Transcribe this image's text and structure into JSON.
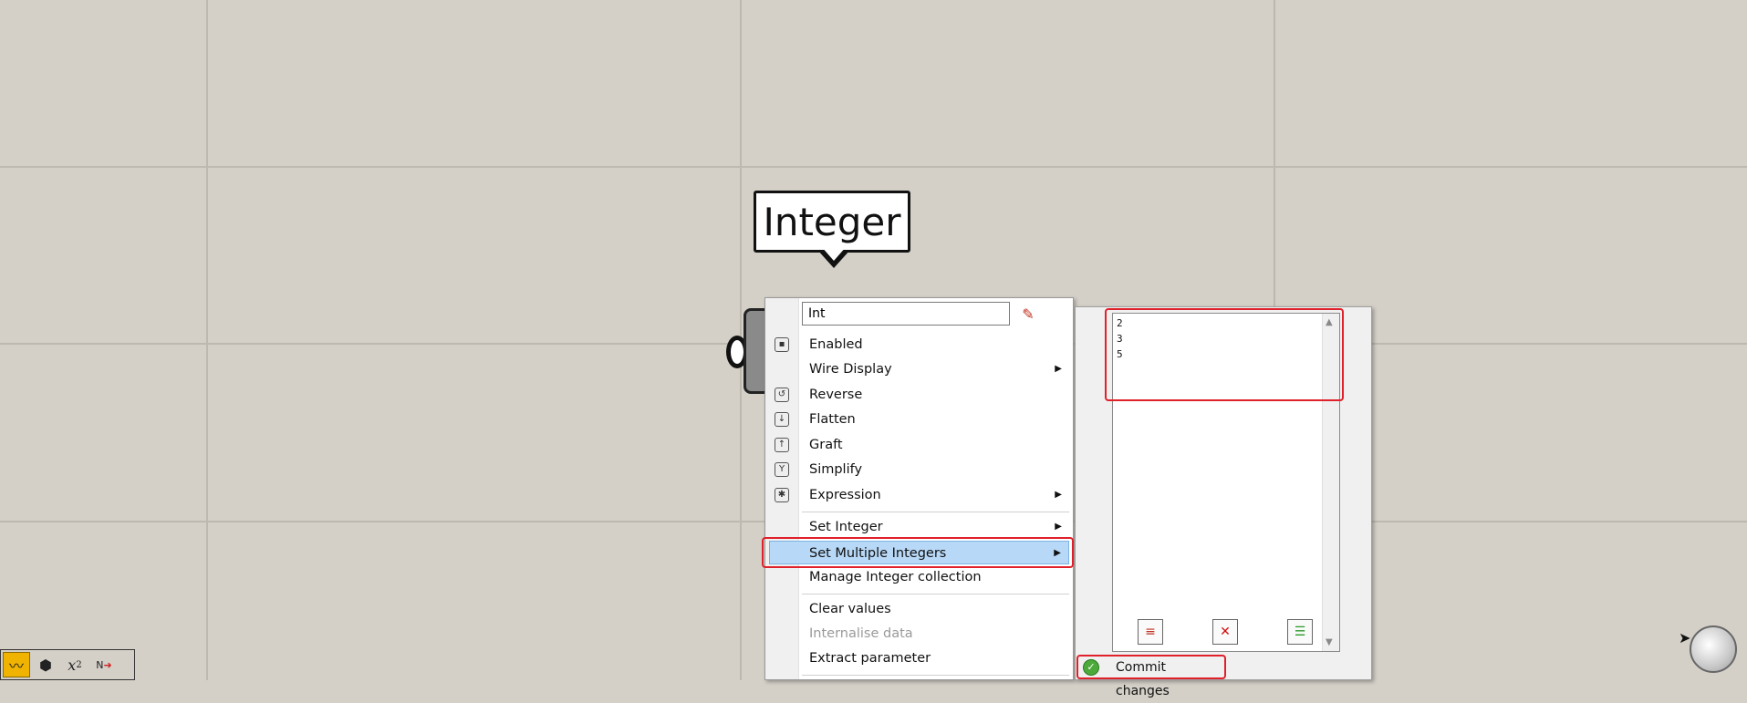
{
  "tooltip": {
    "title": "Integer"
  },
  "menu": {
    "name_value": "Int",
    "items": [
      {
        "label": "Enabled",
        "icon": "enabled-icon",
        "glyph": "▪",
        "submenu": false
      },
      {
        "label": "Wire Display",
        "icon": "",
        "glyph": "",
        "submenu": true
      },
      {
        "label": "Reverse",
        "icon": "reverse-icon",
        "glyph": "↺",
        "submenu": false
      },
      {
        "label": "Flatten",
        "icon": "flatten-icon",
        "glyph": "↓",
        "submenu": false
      },
      {
        "label": "Graft",
        "icon": "graft-icon",
        "glyph": "↑",
        "submenu": false
      },
      {
        "label": "Simplify",
        "icon": "simplify-icon",
        "glyph": "Y",
        "submenu": false
      },
      {
        "label": "Expression",
        "icon": "expression-icon",
        "glyph": "✱",
        "submenu": true
      },
      {
        "label": "Set Integer",
        "submenu": true
      },
      {
        "label": "Set Multiple Integers",
        "submenu": true
      },
      {
        "label": "Manage Integer collection",
        "submenu": false
      },
      {
        "label": "Clear values",
        "submenu": false
      },
      {
        "label": "Internalise data",
        "submenu": false,
        "disabled": true
      },
      {
        "label": "Extract parameter",
        "submenu": false
      }
    ]
  },
  "panel": {
    "lines": [
      "2",
      "3",
      "5"
    ],
    "commit_label": "Commit changes"
  },
  "toolbar": {
    "buttons": [
      "preview-icon",
      "canvas-icon",
      "expression-icon",
      "number-slider-icon"
    ],
    "expr_glyph": "x",
    "expr_sup": "2",
    "n_glyph": "N"
  },
  "colors": {
    "canvas": "#d4d0c8",
    "highlight": "#b7d8f6",
    "annotation": "#e0202a"
  }
}
